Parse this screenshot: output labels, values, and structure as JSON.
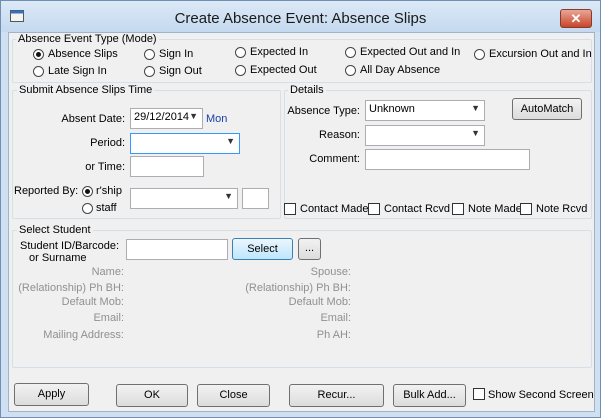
{
  "window": {
    "title": "Create Absence Event: Absence Slips",
    "close_glyph": "✕"
  },
  "mode_group": {
    "legend": "Absence Event Type (Mode)",
    "options": [
      {
        "label": "Absence Slips",
        "selected": true
      },
      {
        "label": "Sign In",
        "selected": false
      },
      {
        "label": "Expected In",
        "selected": false
      },
      {
        "label": "Expected Out and In",
        "selected": false
      },
      {
        "label": "Excursion Out and In",
        "selected": false
      },
      {
        "label": "Late Sign In",
        "selected": false
      },
      {
        "label": "Sign Out",
        "selected": false
      },
      {
        "label": "Expected Out",
        "selected": false
      },
      {
        "label": "All Day Absence",
        "selected": false
      }
    ]
  },
  "submit_group": {
    "legend": "Submit Absence Slips Time",
    "absent_date_label": "Absent Date:",
    "absent_date_value": "29/12/2014",
    "day_label": "Mon",
    "period_label": "Period:",
    "period_value": "",
    "or_time_label": "or Time:",
    "time_value": "",
    "reported_by_label": "Reported By:",
    "reported_options": [
      {
        "label": "r'ship",
        "selected": true
      },
      {
        "label": "staff",
        "selected": false
      }
    ],
    "reporter_value": "",
    "reporter_extra": ""
  },
  "details_group": {
    "legend": "Details",
    "absence_type_label": "Absence Type:",
    "absence_type_value": "Unknown",
    "reason_label": "Reason:",
    "reason_value": "",
    "comment_label": "Comment:",
    "comment_value": "",
    "automatch_label": "AutoMatch",
    "checkboxes": [
      {
        "label": "Contact Made",
        "checked": false
      },
      {
        "label": "Contact Rcvd",
        "checked": false
      },
      {
        "label": "Note Made",
        "checked": false
      },
      {
        "label": "Note Rcvd",
        "checked": false
      }
    ]
  },
  "student_group": {
    "legend": "Select Student",
    "id_label_line1": "Student ID/Barcode:",
    "id_label_line2": "or Surname",
    "id_value": "",
    "select_label": "Select",
    "browse_label": "...",
    "left_fields": [
      "Name:",
      "(Relationship) Ph BH:",
      "Default Mob:",
      "Email:",
      "Mailing Address:"
    ],
    "right_fields": [
      "Spouse:",
      "(Relationship) Ph BH:",
      "Default Mob:",
      "Email:",
      "Ph AH:"
    ]
  },
  "footer": {
    "apply_label": "Apply",
    "ok_label": "OK",
    "close_label": "Close",
    "recur_label": "Recur...",
    "bulk_add_label": "Bulk Add...",
    "show_second_screen_label": "Show Second Screen",
    "show_second_screen_checked": false
  },
  "colors": {
    "accent_link": "#1a3fa8",
    "close_button": "#c8452b",
    "focus_border": "#3399ff"
  }
}
